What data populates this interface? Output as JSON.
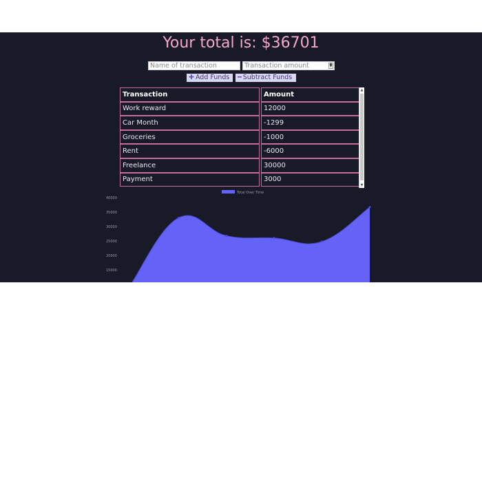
{
  "header": {
    "total_text": "Your total is: $36701"
  },
  "form": {
    "name_placeholder": "Name of transaction",
    "amount_placeholder": "Transaction amount",
    "add_label": "Add Funds",
    "subtract_label": "Subtract Funds",
    "add_icon": "plus-icon",
    "subtract_icon": "minus-icon"
  },
  "table": {
    "headers": [
      "Transaction",
      "Amount"
    ],
    "rows": [
      [
        "Work reward",
        "12000"
      ],
      [
        "Car Month",
        "-1299"
      ],
      [
        "Groceries",
        "-1000"
      ],
      [
        "Rent",
        "-6000"
      ],
      [
        "Freelance",
        "30000"
      ],
      [
        "Payment",
        "3000"
      ]
    ]
  },
  "colors": {
    "background": "#191a28",
    "title": "#f4a7c8",
    "border": "#c66d9e",
    "chart_fill": "#6563f5"
  },
  "chart_data": {
    "type": "area",
    "legend": "Total Over Time",
    "legend_position": "top-center",
    "y_ticks": [
      40000,
      35000,
      30000,
      25000,
      20000,
      15000
    ],
    "ylim": [
      10000,
      40000
    ],
    "x": [
      1,
      2,
      3,
      4,
      5,
      6
    ],
    "values": [
      10000,
      33000,
      26800,
      26000,
      24800,
      36700
    ]
  }
}
